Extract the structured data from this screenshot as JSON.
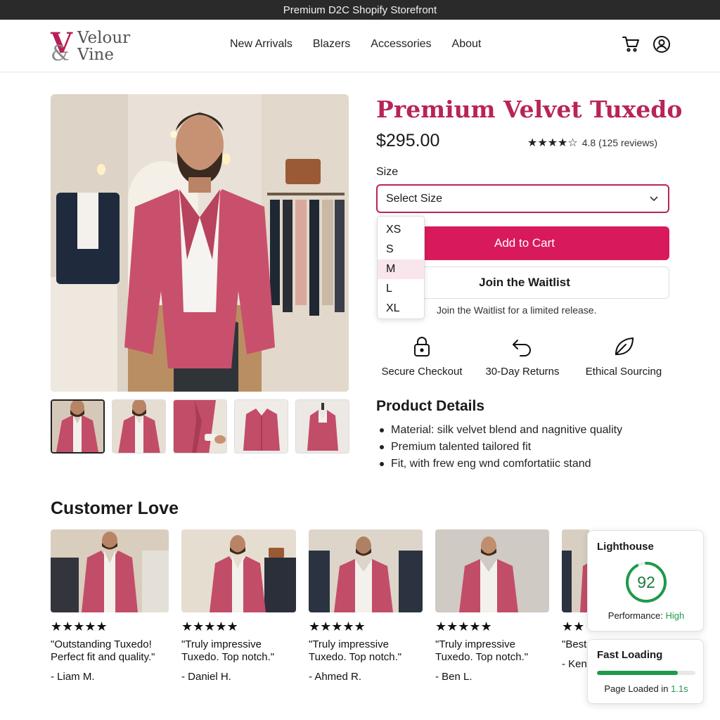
{
  "window": {
    "title": "Premium D2C Shopify Storefront"
  },
  "brand": {
    "mark": "V",
    "amp": "&",
    "line1": "Velour",
    "line2": "Vine",
    "accent": "#b8245a"
  },
  "nav": [
    "New Arrivals",
    "Blazers",
    "Accessories",
    "About"
  ],
  "header_icons": [
    "cart-icon",
    "account-icon"
  ],
  "product": {
    "title": "Premium Velvet Tuxedo",
    "price": "$295.00",
    "rating": {
      "value": 4.8,
      "stars": "★★★★☆",
      "text": "4.8 (125 reviews)"
    },
    "size_label": "Size",
    "size_placeholder": "Select Size",
    "size_options": [
      "XS",
      "S",
      "M",
      "L",
      "XL"
    ],
    "highlighted_option": "M",
    "add_to_cart": "Add to Cart",
    "waitlist": "Join the Waitlist",
    "waitlist_note": "Join the Waitlist for a limited release.",
    "thumbnails_count": 5
  },
  "features": [
    {
      "icon": "lock-icon",
      "label": "Secure Checkout"
    },
    {
      "icon": "return-arrow-icon",
      "label": "30-Day Returns"
    },
    {
      "icon": "leaf-icon",
      "label": "Ethical Sourcing"
    }
  ],
  "details": {
    "title": "Product Details",
    "items": [
      "Material: silk velvet blend and nagnitive quality",
      "Premium talented tailored fit",
      "Fit, with frew eng wnd comfortatiic stand"
    ]
  },
  "reviews": {
    "title": "Customer Love",
    "items": [
      {
        "stars": "★★★★★",
        "quote": "\"Outstanding Tuxedo! Perfect fit and quality.\"",
        "author": "- Liam M."
      },
      {
        "stars": "★★★★★",
        "quote": "\"Truly impressive Tuxedo. Top notch.\"",
        "author": "- Daniel H."
      },
      {
        "stars": "★★★★★",
        "quote": "\"Truly impressive Tuxedo. Top notch.\"",
        "author": "- Ahmed R."
      },
      {
        "stars": "★★★★★",
        "quote": "\"Truly impressive Tuxedo. Top notch.\"",
        "author": "- Ben L."
      },
      {
        "stars": "★★",
        "quote": "\"Best prefe",
        "author": "- Ken"
      }
    ]
  },
  "lighthouse": {
    "title": "Lighthouse",
    "score": 92,
    "score_fraction": 0.92,
    "perf_label": "Performance:",
    "perf_value": "High"
  },
  "fast_loading": {
    "title": "Fast Loading",
    "progress": 0.82,
    "loaded_label": "Page Loaded in",
    "loaded_value": "1.1s"
  },
  "colors": {
    "primary": "#d81a5d",
    "title": "#b8245a",
    "success": "#1e9a4a",
    "topbar": "#2a2a2a"
  }
}
